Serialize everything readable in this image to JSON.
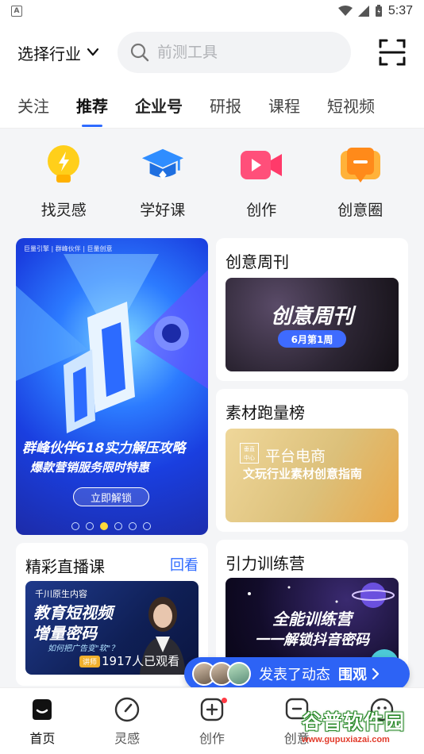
{
  "status_bar": {
    "time": "5:37",
    "badge": "A"
  },
  "header": {
    "industry_label": "选择行业",
    "search_placeholder": "前测工具"
  },
  "tabs": [
    {
      "label": "关注"
    },
    {
      "label": "推荐",
      "active": true
    },
    {
      "label": "企业号"
    },
    {
      "label": "研报"
    },
    {
      "label": "课程"
    },
    {
      "label": "短视频"
    }
  ],
  "quick_actions": [
    {
      "label": "找灵感",
      "icon": "lightbulb-icon",
      "color": "#ffcf1a"
    },
    {
      "label": "学好课",
      "icon": "graduation-cap-icon",
      "color": "#2f8dff"
    },
    {
      "label": "创作",
      "icon": "video-camera-icon",
      "color": "#ff4f7a"
    },
    {
      "label": "创意圈",
      "icon": "chat-square-icon",
      "color": "#ff9a1a"
    }
  ],
  "banner": {
    "logos": "巨量引擎 | 群峰伙伴 | 巨量创意",
    "headline": "群峰伙伴618实力解压攻略",
    "subheadline": "爆款营销服务限时特惠",
    "cta": "立即解锁",
    "slide_count": 6,
    "active_slide": 3
  },
  "cards": {
    "weekly": {
      "title": "创意周刊",
      "art_title": "创意周刊",
      "art_tag": "6月第1周"
    },
    "material": {
      "title": "素材跑量榜",
      "badge": "垂直 中心",
      "art_line1": "平台电商",
      "art_line2": "文玩行业素材创意指南"
    },
    "live": {
      "title": "精彩直播课",
      "more": "回看",
      "art_line0": "千川原生内容",
      "art_line1": "教育短视频",
      "art_line2": "增量密码",
      "art_line3": "如何把广告变\"软\"？",
      "speaker_tag": "讲师",
      "viewers": "1917人已观看"
    },
    "camp": {
      "title": "引力训练营",
      "art_line1": "全能训练营",
      "art_line2": "一一解锁抖音密码"
    }
  },
  "floating": {
    "text": "发表了动态",
    "cta": "围观"
  },
  "bottom_nav": [
    {
      "label": "首页",
      "icon": "home-icon",
      "active": true
    },
    {
      "label": "灵感",
      "icon": "compass-icon"
    },
    {
      "label": "创作",
      "icon": "plus-square-icon",
      "dot": true
    },
    {
      "label": "创意",
      "icon": "message-square-icon"
    },
    {
      "label": "",
      "icon": "smile-face-icon"
    }
  ],
  "watermark": {
    "brand": "谷普软件园",
    "url": "www.gupuxiazai.com"
  },
  "colors": {
    "accent": "#2f6bff",
    "float_bg": "#2d63f5",
    "red_dot": "#ff3a44",
    "page_bg": "#f4f5f7"
  }
}
